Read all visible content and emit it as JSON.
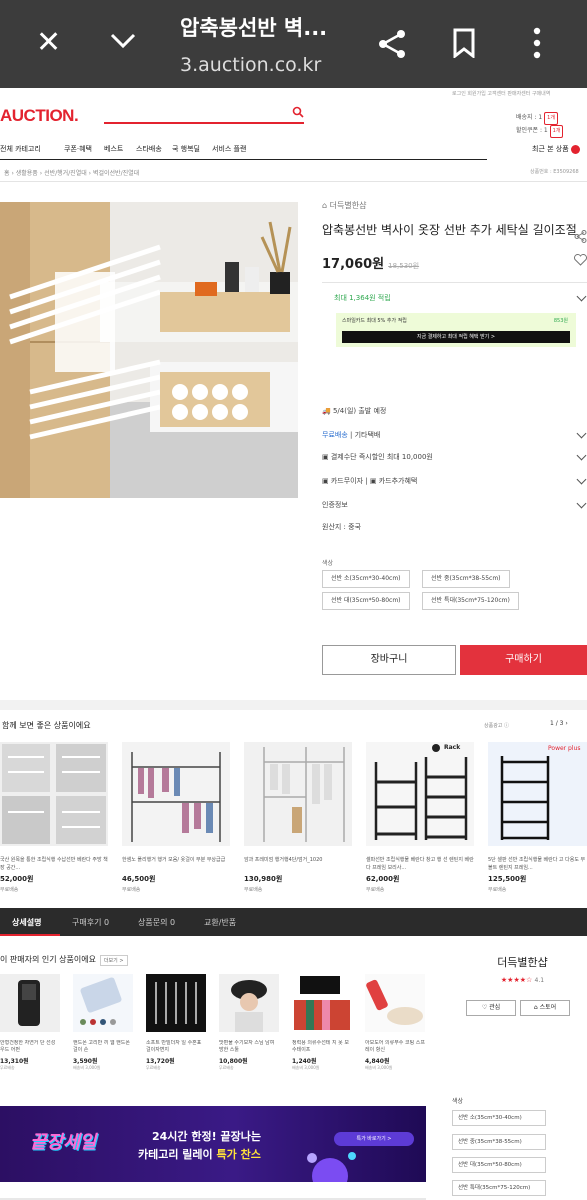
{
  "browser": {
    "title": "압축봉선반 벽...",
    "url": "3.auction.co.kr"
  },
  "site": {
    "logo": "AUCTION.",
    "utility_links": "로그인 회원가입 고객센터 판매자센터 구매내역",
    "side_labels": [
      "배송지 : 1",
      "할인쿠폰 : 1"
    ],
    "side_badges": [
      "1개",
      "1개"
    ]
  },
  "gnb": {
    "items": [
      "전체 카테고리",
      "쿠폰·혜택",
      "베스트",
      "스타배송",
      "국 행복딜",
      "서비스 플랜"
    ],
    "recent": "최근 본 상품"
  },
  "breadcrumb": {
    "items": [
      "홈",
      "생활용품",
      "선반/행거/진열대",
      "벽걸이선반/진열대"
    ],
    "product_no": "상품번호 : E3509268"
  },
  "product": {
    "seller": "더득별한샵",
    "title": "압축봉선반 벽사이 옷장 선반 추가 세탁실 길이조절",
    "price": "17,060원",
    "original_price": "18,530원",
    "max_point": "최대 1,364원 적립",
    "point_line": "스마일카드 최대 5% 추가 적립",
    "point_amount": "853원",
    "point_bar": "지금 결제하고 최대 적립 혜택 받기 >",
    "delivery": "5/4(일) 출발 예정",
    "shipping_free": "무료배송",
    "shipping_other": "기타택배",
    "payment": "결제수단 즉시할인 최대 10,000원",
    "card1": "카드무이자",
    "card2": "카드추가혜택",
    "cert": "인증정보",
    "origin": "원산지 : 중국",
    "option_label": "색상",
    "options": [
      "선반 소(35cm*30-40cm)",
      "선반 중(35cm*38-55cm)",
      "선반 대(35cm*50-80cm)",
      "선반 특대(35cm*75-120cm)"
    ],
    "cart_button": "장바구니",
    "buy_button": "구매하기"
  },
  "recommend": {
    "title": "함께 보면 좋은 상품이에요",
    "meta": "상품광고 ⓘ",
    "page": "1 / 3",
    "cards": [
      {
        "name": "국산 원목을 통한 조립식행 수납선반 베란다 주방 책장 공간...",
        "price": "52,000원",
        "ship": "무료배송"
      },
      {
        "name": "한샘노 폴리행거 행거 모음/ 옷걸이 부분 부상급급",
        "price": "46,500원",
        "ship": "무료배송"
      },
      {
        "name": "암과 프레미엄 행거행4단/엄거_1020",
        "price": "130,980원",
        "ship": "무료배송"
      },
      {
        "name": "셀파선반 조립식행물 베란다 창고 행 선 렌틴지 베란다 프레임 보리사...",
        "price": "62,000원",
        "ship": "무료배송"
      },
      {
        "name": "5단 셀판 선반 조립식행물 베란다 고 다용도 무볼트 렌틴지 프레임...",
        "price": "125,500원",
        "ship": "무료배송"
      }
    ],
    "rack_logo": "Rack"
  },
  "tabs": {
    "items": [
      "상세설명",
      "구매후기 0",
      "상품문의 0",
      "교환/반품"
    ]
  },
  "seller_popular": {
    "title": "이 판매자의 인기 상품이에요",
    "more": "더보기 >",
    "cards": [
      {
        "name": "안형건정한 자연거 단 선성 우드 어펀",
        "price": "13,310원",
        "ship": "무료배송"
      },
      {
        "name": "핸드폰 고리만 끼 웹 핸드폰 걸이 손",
        "price": "3,590원",
        "ship": "배송비 3,000원"
      },
      {
        "name": "소프트 만빌더자 일 수혼표 걸이자변지",
        "price": "13,720원",
        "ship": "무료배송"
      },
      {
        "name": "맛편물 수기모자 스님 남여 방한 스툴",
        "price": "10,800원",
        "ship": "무료배송"
      },
      {
        "name": "정력용 의류수선테 지 못 보수테이프",
        "price": "1,240원",
        "ship": "배송비 3,000원"
      },
      {
        "name": "아모도어 의류부수 코팅 스프레이 항신",
        "price": "4,840원",
        "ship": "배송비 3,000원"
      }
    ]
  },
  "store": {
    "name": "더득별한샵",
    "rating": "★★★★☆",
    "score": "4.1",
    "like_button": "♡ 관심",
    "store_button": "⌂ 스토어"
  },
  "banner": {
    "logo": "끝장세일",
    "line1": "24시간 한정! 끝장나는",
    "line2_a": "카테고리 릴레이 ",
    "line2_b": "특가 찬스",
    "pill": "특가 바로가기 >"
  },
  "side_options": {
    "label": "색상",
    "items": [
      "선반 소(35cm*30-40cm)",
      "선반 중(35cm*38-55cm)",
      "선반 대(35cm*50-80cm)",
      "선반 특대(35cm*75-120cm)"
    ]
  },
  "colors": {
    "accent": "#e3232f",
    "buy": "#e3323d",
    "point_green": "#2fa84f"
  }
}
